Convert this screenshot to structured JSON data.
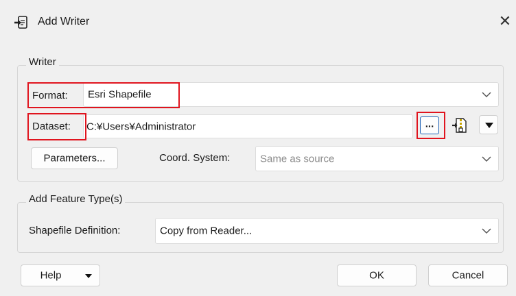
{
  "window": {
    "title": "Add Writer",
    "close_glyph": "✕"
  },
  "writer_group": {
    "legend": "Writer",
    "format": {
      "label": "Format:",
      "value": "Esri Shapefile"
    },
    "dataset": {
      "label": "Dataset:",
      "value": "C:¥Users¥Administrator",
      "browse_label": "..."
    },
    "parameters_button": "Parameters...",
    "coord_system": {
      "label": "Coord. System:",
      "value": "Same as source"
    }
  },
  "feature_group": {
    "legend": "Add Feature Type(s)",
    "shapefile_definition": {
      "label": "Shapefile Definition:",
      "value": "Copy from Reader..."
    }
  },
  "footer": {
    "help": "Help",
    "ok": "OK",
    "cancel": "Cancel"
  },
  "colors": {
    "highlight": "#e0141e",
    "accent": "#1a5fb4"
  },
  "icons": [
    "writer-icon",
    "close-icon",
    "chevron-down-icon",
    "browse-icon",
    "zip-file-icon",
    "dropdown-arrow-icon"
  ]
}
